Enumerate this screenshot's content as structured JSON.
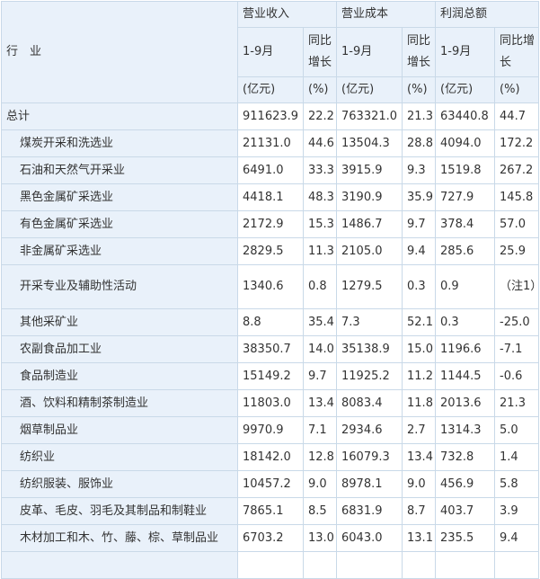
{
  "header": {
    "industry_label": "行　业",
    "groups": [
      "营业收入",
      "营业成本",
      "利润总额"
    ],
    "period_label": "1-9月",
    "growth_label": "同比增长",
    "unit_value": "(亿元)",
    "unit_pct": "(%)"
  },
  "rows": [
    {
      "name": "总计",
      "v": [
        "911623.9",
        "22.2",
        "763321.0",
        "21.3",
        "63440.8",
        "44.7"
      ]
    },
    {
      "name": "煤炭开采和洗选业",
      "v": [
        "21131.0",
        "44.6",
        "13504.3",
        "28.8",
        "4094.0",
        "172.2"
      ]
    },
    {
      "name": "石油和天然气开采业",
      "v": [
        "6491.0",
        "33.3",
        "3915.9",
        "9.3",
        "1519.8",
        "267.2"
      ]
    },
    {
      "name": "黑色金属矿采选业",
      "v": [
        "4418.1",
        "48.3",
        "3190.9",
        "35.9",
        "727.9",
        "145.8"
      ]
    },
    {
      "name": "有色金属矿采选业",
      "v": [
        "2172.9",
        "15.3",
        "1486.7",
        "9.7",
        "378.4",
        "57.0"
      ]
    },
    {
      "name": "非金属矿采选业",
      "v": [
        "2829.5",
        "11.3",
        "2105.0",
        "9.4",
        "285.6",
        "25.9"
      ]
    },
    {
      "name": "开采专业及辅助性活动",
      "v": [
        "1340.6",
        "0.8",
        "1279.5",
        "0.3",
        "0.9",
        "（注1）"
      ]
    },
    {
      "name": "其他采矿业",
      "v": [
        "8.8",
        "35.4",
        "7.3",
        "52.1",
        "0.3",
        "-25.0"
      ]
    },
    {
      "name": "农副食品加工业",
      "v": [
        "38350.7",
        "14.0",
        "35138.9",
        "15.0",
        "1196.6",
        "-7.1"
      ]
    },
    {
      "name": "食品制造业",
      "v": [
        "15149.2",
        "9.7",
        "11925.2",
        "11.2",
        "1144.5",
        "-0.6"
      ]
    },
    {
      "name": "酒、饮料和精制茶制造业",
      "v": [
        "11803.0",
        "13.4",
        "8083.4",
        "11.8",
        "2013.6",
        "21.3"
      ]
    },
    {
      "name": "烟草制品业",
      "v": [
        "9970.9",
        "7.1",
        "2934.6",
        "2.7",
        "1314.3",
        "5.0"
      ]
    },
    {
      "name": "纺织业",
      "v": [
        "18142.0",
        "12.8",
        "16079.3",
        "13.4",
        "732.8",
        "1.4"
      ]
    },
    {
      "name": "纺织服装、服饰业",
      "v": [
        "10457.2",
        "9.0",
        "8978.1",
        "9.0",
        "456.9",
        "5.8"
      ]
    },
    {
      "name": "皮革、毛皮、羽毛及其制品和制鞋业",
      "v": [
        "7865.1",
        "8.5",
        "6831.9",
        "8.7",
        "403.7",
        "3.9"
      ]
    },
    {
      "name": "木材加工和木、竹、藤、棕、草制品业",
      "v": [
        "6703.2",
        "13.0",
        "6043.0",
        "13.1",
        "235.5",
        "9.4"
      ]
    },
    {
      "name": "",
      "v": [
        "",
        "",
        "",
        "",
        "",
        ""
      ]
    }
  ]
}
